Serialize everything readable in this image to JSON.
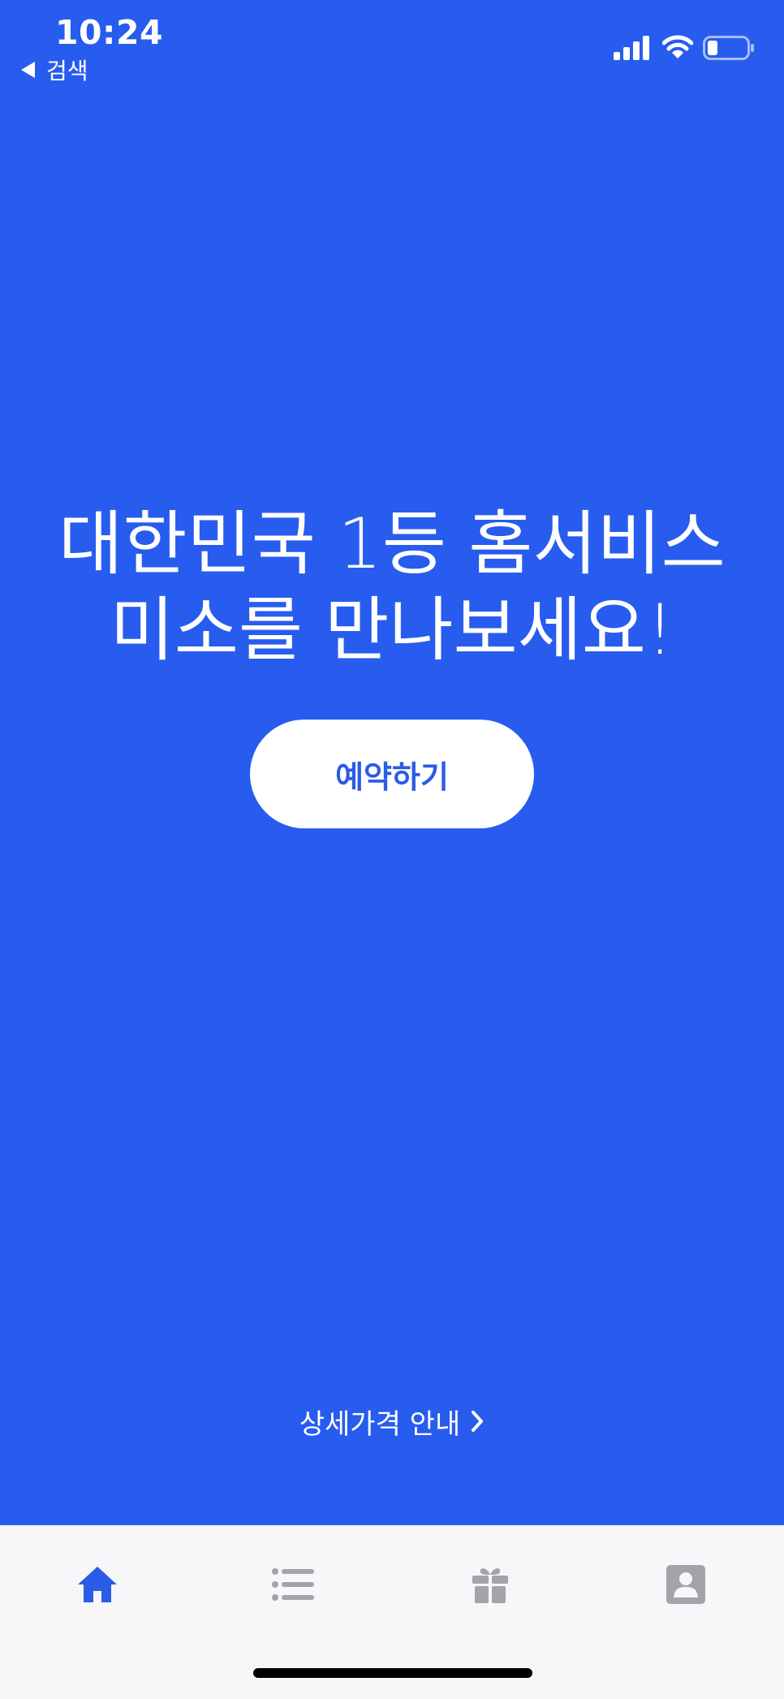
{
  "status_bar": {
    "time": "10:24",
    "back_label": "검색",
    "icons": [
      "signal-icon",
      "wifi-icon",
      "battery-icon"
    ]
  },
  "hero": {
    "line1": "대한민국 1등 홈서비스",
    "line2": "미소를 만나보세요!"
  },
  "actions": {
    "reserve_label": "예약하기",
    "price_link_label": "상세가격 안내"
  },
  "tab_bar": {
    "tabs": [
      {
        "icon": "home-icon",
        "active": true
      },
      {
        "icon": "list-icon",
        "active": false
      },
      {
        "icon": "gift-icon",
        "active": false
      },
      {
        "icon": "profile-icon",
        "active": false
      }
    ]
  },
  "colors": {
    "background": "#275CEE",
    "button_text": "#2A5CE5",
    "tab_active": "#2A5CE5",
    "tab_inactive": "#A3A3A8",
    "tab_bar_bg": "#F7F7FA"
  }
}
